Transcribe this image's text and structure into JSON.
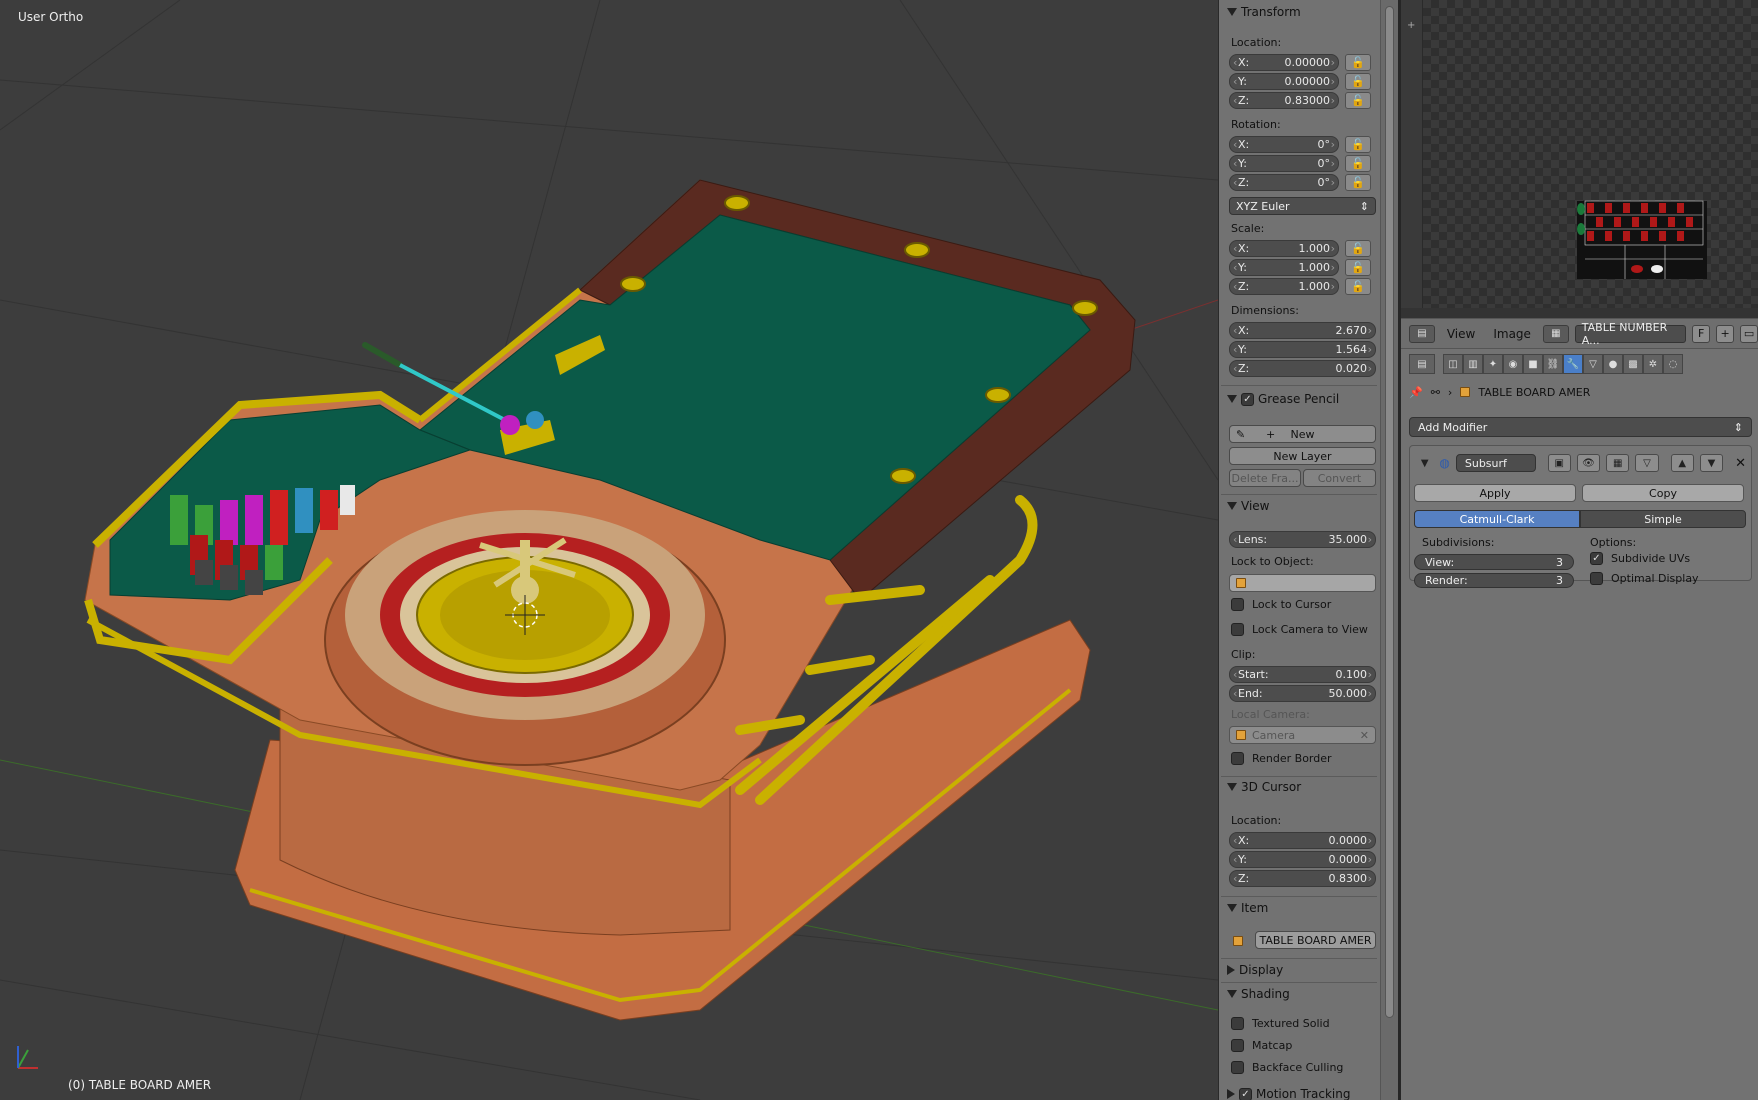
{
  "viewport": {
    "view_name": "User Ortho",
    "active_object_label": "(0) TABLE BOARD AMER"
  },
  "npanel": {
    "transform": {
      "title": "Transform",
      "location_label": "Location:",
      "location": [
        {
          "axis": "X:",
          "value": "0.00000"
        },
        {
          "axis": "Y:",
          "value": "0.00000"
        },
        {
          "axis": "Z:",
          "value": "0.83000"
        }
      ],
      "rotation_label": "Rotation:",
      "rotation": [
        {
          "axis": "X:",
          "value": "0°"
        },
        {
          "axis": "Y:",
          "value": "0°"
        },
        {
          "axis": "Z:",
          "value": "0°"
        }
      ],
      "rotation_mode": "XYZ Euler",
      "scale_label": "Scale:",
      "scale": [
        {
          "axis": "X:",
          "value": "1.000"
        },
        {
          "axis": "Y:",
          "value": "1.000"
        },
        {
          "axis": "Z:",
          "value": "1.000"
        }
      ],
      "dimensions_label": "Dimensions:",
      "dimensions": [
        {
          "axis": "X:",
          "value": "2.670"
        },
        {
          "axis": "Y:",
          "value": "1.564"
        },
        {
          "axis": "Z:",
          "value": "0.020"
        }
      ]
    },
    "grease_pencil": {
      "title": "Grease Pencil",
      "new_label": "New",
      "new_layer_label": "New Layer",
      "delete_frame_label": "Delete Fra...",
      "convert_label": "Convert"
    },
    "view": {
      "title": "View",
      "lens_label": "Lens:",
      "lens_value": "35.000",
      "lock_to_object_label": "Lock to Object:",
      "lock_to_cursor_label": "Lock to Cursor",
      "lock_camera_label": "Lock Camera to View",
      "clip_label": "Clip:",
      "clip_start_label": "Start:",
      "clip_start_value": "0.100",
      "clip_end_label": "End:",
      "clip_end_value": "50.000",
      "local_camera_label": "Local Camera:",
      "camera_placeholder": "Camera",
      "render_border_label": "Render Border"
    },
    "cursor": {
      "title": "3D Cursor",
      "location_label": "Location:",
      "location": [
        {
          "axis": "X:",
          "value": "0.0000"
        },
        {
          "axis": "Y:",
          "value": "0.0000"
        },
        {
          "axis": "Z:",
          "value": "0.8300"
        }
      ]
    },
    "item": {
      "title": "Item",
      "name": "TABLE BOARD AMER"
    },
    "display": {
      "title": "Display"
    },
    "shading": {
      "title": "Shading",
      "textured_solid": "Textured Solid",
      "matcap": "Matcap",
      "backface_culling": "Backface Culling"
    },
    "motion_tracking": {
      "title": "Motion Tracking"
    }
  },
  "image_editor": {
    "menu_view": "View",
    "menu_image": "Image",
    "image_name": "TABLE NUMBER A...",
    "fake_user": "F"
  },
  "properties": {
    "object_name": "TABLE BOARD AMER",
    "add_modifier_label": "Add Modifier",
    "modifier": {
      "name": "Subsurf",
      "apply_label": "Apply",
      "copy_label": "Copy",
      "catmull_label": "Catmull-Clark",
      "simple_label": "Simple",
      "subdivisions_label": "Subdivisions:",
      "options_label": "Options:",
      "view_label": "View:",
      "view_value": "3",
      "render_label": "Render:",
      "render_value": "3",
      "subdivide_uvs_label": "Subdivide UVs",
      "optimal_display_label": "Optimal Display"
    }
  },
  "colors": {
    "felt": "#0b5a48",
    "gold": "#c9b100",
    "copper": "#c8744a",
    "wood": "#5a2a20",
    "accent": "#5680c2"
  }
}
